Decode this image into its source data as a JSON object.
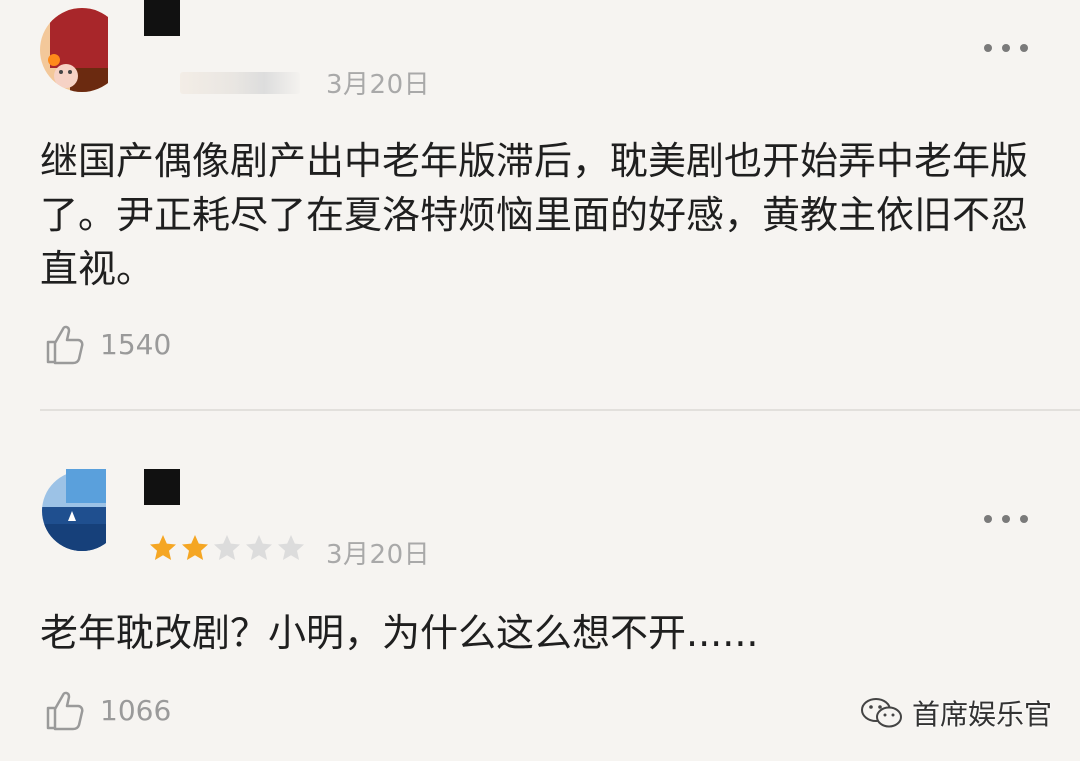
{
  "comments": [
    {
      "date": "3月20日",
      "text": "继国产偶像剧产出中老年版滞后，耽美剧也开始弄中老年版了。尹正耗尽了在夏洛特烦恼里面的好感，黄教主依旧不忍直视。",
      "likes": "1540"
    },
    {
      "date": "3月20日",
      "rating": 2,
      "rating_max": 5,
      "text": "老年耽改剧？小明，为什么这么想不开......",
      "likes": "1066"
    }
  ],
  "watermark": {
    "text": "首席娱乐官",
    "icon": "wechat-icon"
  },
  "colors": {
    "background": "#f6f4f1",
    "star_filled": "#f5a623",
    "star_empty": "#dcdcdc",
    "meta_gray": "#a9a9a9"
  }
}
